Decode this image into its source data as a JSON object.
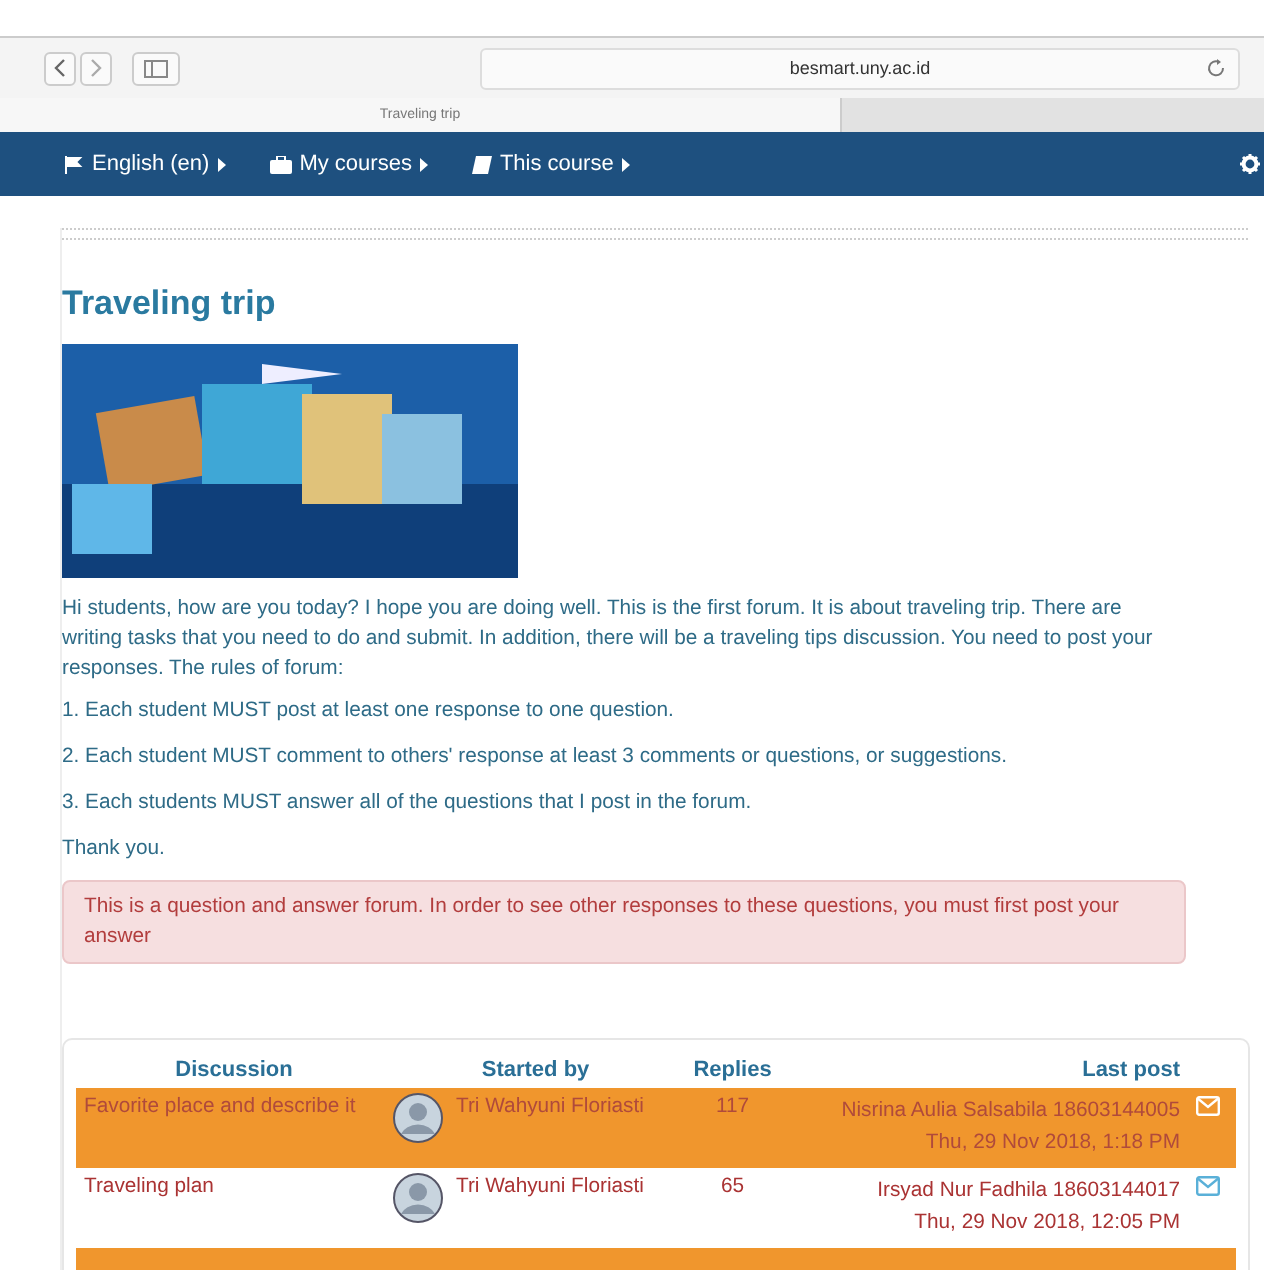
{
  "browser": {
    "url": "besmart.uny.ac.id",
    "tab_title": "Traveling trip"
  },
  "navbar": {
    "items": [
      {
        "label": "English (en)",
        "kind": "language"
      },
      {
        "label": "My courses",
        "kind": "courses"
      },
      {
        "label": "This course",
        "kind": "course"
      }
    ]
  },
  "forum": {
    "title": "Traveling trip",
    "intro": "Hi students, how are you today? I hope you are doing well. This is the first forum. It is about traveling trip. There are writing tasks that you need to do and submit. In addition, there will be a traveling tips discussion. You need to post your responses. The rules of forum:",
    "rules": [
      "1. Each student MUST post at least one response to one question.",
      "2. Each student MUST comment to others' response at least 3 comments or questions, or suggestions.",
      "3. Each students MUST answer all of the questions that I post in the forum."
    ],
    "closing": "Thank you.",
    "notice": "This is a question and answer forum. In order to see other responses to these questions, you must first post your answer"
  },
  "table": {
    "columns": [
      "Discussion",
      "Started by",
      "Replies",
      "Last post"
    ],
    "rows": [
      {
        "discussion": "Favorite place and describe it",
        "started_by": "Tri Wahyuni Floriasti",
        "replies": "117",
        "last_post_author": "Nisrina Aulia Salsabila 18603144005",
        "last_post_date": "Thu, 29 Nov 2018, 1:18 PM"
      },
      {
        "discussion": "Traveling plan",
        "started_by": "Tri Wahyuni Floriasti",
        "replies": "65",
        "last_post_author": "Irsyad Nur Fadhila 18603144017",
        "last_post_date": "Thu, 29 Nov 2018, 12:05 PM"
      }
    ]
  }
}
